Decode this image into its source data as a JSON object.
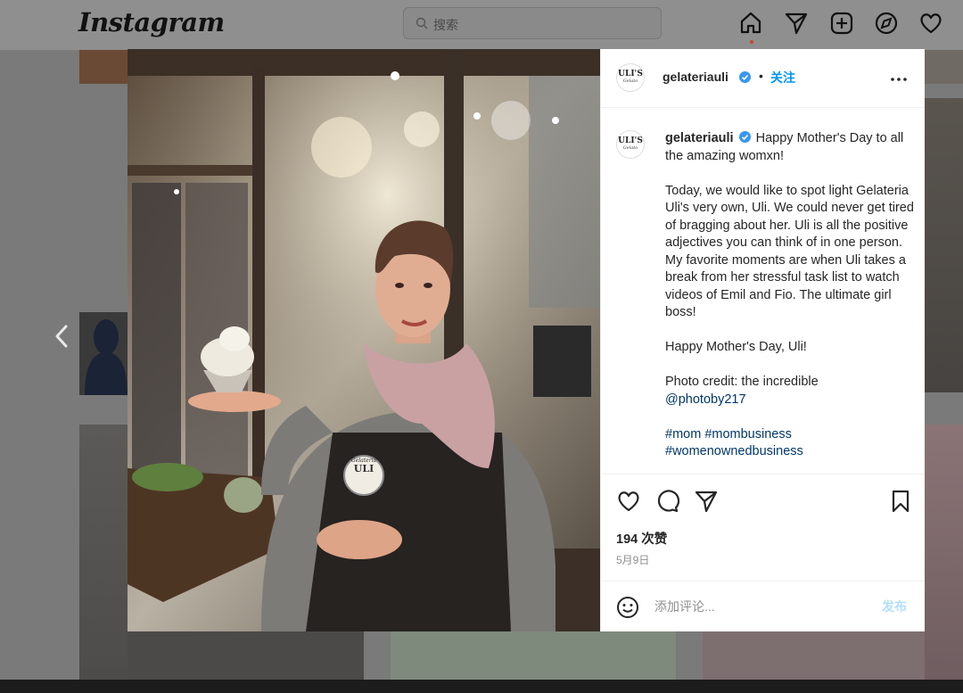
{
  "app": {
    "logo": "Instagram",
    "search_placeholder": "搜索",
    "nav_icons": [
      "home-icon",
      "direct-icon",
      "new-post-icon",
      "explore-icon",
      "activity-icon"
    ]
  },
  "post": {
    "username": "gelateriauli",
    "avatar_text": "ULI'S",
    "avatar_subtext": "Gelato",
    "separator": "•",
    "follow_label": "关注",
    "apron_text_top": "Gelateria",
    "apron_text_main": "ULI",
    "caption": {
      "line1": "Happy Mother's Day to all the amazing womxn!",
      "para2": "Today, we would like to spot light Gelateria Uli's very own, Uli. We could never get tired of bragging about her. Uli is all the positive adjectives you can think of in one person. My favorite moments are when Uli takes a break from her stressful task list to watch videos of Emil and Fio. The ultimate girl boss!",
      "para3": "Happy Mother's Day, Uli!",
      "credit": "Photo credit: the incredible",
      "credit_handle": "@photoby217",
      "hashtag1": "#mom",
      "hashtag2": "#mombusiness",
      "hashtag3": "#womenownedbusiness"
    },
    "likes": "194 次赞",
    "date": "5月9日",
    "comment_placeholder": "添加评论...",
    "post_label": "发布"
  },
  "colors": {
    "accent": "#0095f6",
    "link": "#00376b",
    "verified": "#3897f0"
  }
}
